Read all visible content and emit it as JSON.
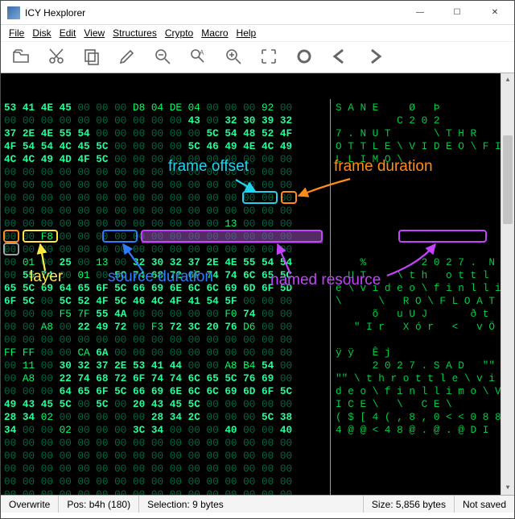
{
  "window": {
    "title": "ICY Hexplorer",
    "minimize_glyph": "—",
    "maximize_glyph": "☐",
    "close_glyph": "✕"
  },
  "menu": {
    "items": [
      "File",
      "Disk",
      "Edit",
      "View",
      "Structures",
      "Crypto",
      "Macro",
      "Help"
    ]
  },
  "toolbar": {
    "icons": [
      "open-icon",
      "cut-icon",
      "copy-icon",
      "edit-icon",
      "zoom-out-icon",
      "find-text-icon",
      "zoom-in-icon",
      "fit-icon",
      "blob-icon",
      "back-icon",
      "forward-icon"
    ]
  },
  "status": {
    "mode": "Overwrite",
    "pos_label": "Pos: b4h (180)",
    "sel_label": "Selection: 9 bytes",
    "size_label": "Size: 5,856 bytes",
    "saved": "Not saved"
  },
  "annotations": {
    "frame_offset": "frame offset",
    "frame_duration": "frame duration",
    "layer": "layer",
    "source_duration": "source duration",
    "named_resource": "named resource"
  },
  "hex": {
    "left_rows": [
      "53 41 4E 45 00 00 00 D8 04 DE 04 00 00 00 92 00",
      "00 00 00 00 00 00 00 00 00 00 43 00 32 30 39 32",
      "37 2E 4E 55 54 00 00 00 00 00 00 5C 54 48 52 4F",
      "4F 54 54 4C 45 5C 00 00 00 00 5C 46 49 4E 4C 49",
      "4C 4C 49 4D 4F 5C 00 00 00 00 00 00 00 00 00 00",
      "00 00 00 00 00 00 00 00 00 00 00 00 00 00 00 00",
      "00 00 00 00 00 00 00 00 00 00 00 00 00 00 00 00",
      "00 00 00 00 00 00 00 00 00 00 00 00 00 00 00 00",
      "00 00 00 00 00 00 00 00 00 00 00 00 00 00 00 00",
      "00 00 00 00 00 00 00 00 00 00 00 00 13 00 00 00",
      "00 00 F8 00 00 00 00 00 00 00 00 00 00 00 00 00",
      "00 00 00 00 00 00 00 00 00 00 00 00 00 00 00 00",
      "00 01 00 25 00 13 00 32 30 32 37 2E 4E 55 54 54",
      "00 55 74 00 01 00 5C 74 68 72 6F 74 74 6C 65 5C",
      "65 5C 69 64 65 6F 5C 66 69 6E 6C 6C 69 6D 6F 5D",
      "6F 5C 00 5C 52 4F 5C 46 4C 4F 41 54 5F 00 00 00",
      "00 00 00 F5 7F 55 4A 00 00 00 00 00 F0 74 00 00",
      "00 00 A8 00 22 49 72 00 F3 72 3C 20 76 D6 00 00",
      "00 00 00 00 00 00 00 00 00 00 00 00 00 00 00 00",
      "FF FF 00 00 CA 6A 00 00 00 00 00 00 00 00 00 00",
      "00 11 00 30 32 37 2E 53 41 44 00 00 A8 B4 54 00",
      "00 A8 00 22 74 68 72 6F 74 74 6C 65 5C 76 69 00",
      "00 00 00 64 65 6F 5C 66 69 6E 6C 6C 69 6D 6F 5C",
      "49 43 45 5C 00 5C 00 20 43 45 5C 00 00 00 00 00",
      "28 34 02 00 00 00 00 00 28 34 2C 00 00 00 5C 38",
      "34 00 00 02 00 00 00 3C 34 00 00 00 40 00 00 40",
      "00 00 00 00 00 00 00 00 00 00 00 00 00 00 00 00",
      "00 00 00 00 00 00 00 00 00 00 00 00 00 00 00 00",
      "00 00 00 00 00 00 00 00 00 00 00 00 00 00 00 00",
      "00 00 00 00 00 00 00 00 00 00 00 00 00 00 00 00",
      "00 00 00 00 00 00 00 00 00 00 00 00 00 00 00 00",
      "00 00 00 00 00 00 00 00 00 00 00 00 00 00 00 00"
    ],
    "right_rows": [
      "S A N E     Ø   Þ",
      "          C 2 0 2",
      "7 . N U T       \\ T H R",
      "O T T L E \\ V I D E O \\ F I N",
      "L L I M O \\",
      " ",
      " ",
      " ",
      " ",
      "                      ",
      "                      ",
      "  ",
      "    %         2 0 2 7 .  N U T",
      "  U T     \\ t h   o t t l",
      "e \\ v i d e o \\ f i n l l i m o",
      "\\      \\   R O \\ F L O A T _",
      "      õ   u U J       ð t",
      "   \" I r   X ó r   <   v Ö",
      " ",
      "ÿ ÿ   Ê j",
      "      2 0 2 7 . S A D   \"\" T",
      "\"\" \\ t h r o t t l e \\ v i",
      "d e o \\ f i n l l i m o \\ V O",
      "I C E \\   \\   C E \\",
      "( $ [ 4 ( , 8 , 0 < < 0 8 8 8",
      "4 @ @ < 4 8 @ . @ . @ D I",
      " ",
      " ",
      " ",
      " ",
      " ",
      " "
    ]
  }
}
